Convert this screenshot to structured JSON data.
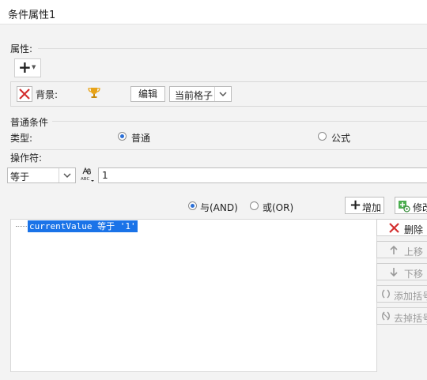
{
  "window": {
    "title": "条件属性1"
  },
  "attributes": {
    "section_label": "属性:",
    "background_label": "背景:",
    "edit_label": "编辑",
    "scope_value": "当前格子"
  },
  "common_condition": {
    "section_label": "普通条件",
    "type_label": "类型:",
    "type_normal": "普通",
    "type_formula": "公式",
    "operator_label": "操作符:",
    "operator_value": "等于",
    "operand_value": "1"
  },
  "logic": {
    "and_label": "与(AND)",
    "or_label": "或(OR)",
    "add_label": "增加",
    "modify_label": "修改"
  },
  "condition_list": [
    {
      "expression": "currentValue 等于 '1'"
    }
  ],
  "side_buttons": {
    "delete": "删除",
    "move_up": "上移",
    "move_down": "下移",
    "add_bracket": "添加括号",
    "remove_bracket": "去掉括号"
  },
  "colors": {
    "accent": "#2b6fd6",
    "selection": "#1a73e8",
    "delete_red": "#d32f2f",
    "trophy": "#e8a317"
  }
}
